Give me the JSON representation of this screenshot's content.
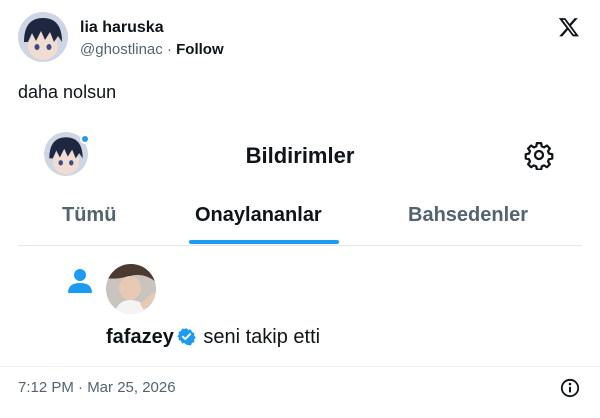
{
  "tweet": {
    "author_name": "lia haruska",
    "handle": "@ghostlinac",
    "separator": "·",
    "follow_label": "Follow",
    "text": "daha nolsun",
    "timestamp": "7:12 PM · Mar 25, 2026"
  },
  "screenshot": {
    "title": "Bildirimler",
    "tabs": [
      {
        "label": "Tümü",
        "active": false
      },
      {
        "label": "Onaylananlar",
        "active": true
      },
      {
        "label": "Bahsedenler",
        "active": false
      }
    ],
    "notification": {
      "username": "fafazey",
      "action": "seni takip etti"
    }
  },
  "icons": {
    "brand": "x-logo-icon",
    "settings": "gear-icon",
    "follow": "person-icon",
    "verified": "verified-badge-icon",
    "info": "info-icon"
  },
  "colors": {
    "accent": "#1d9bf0",
    "text": "#0f1419",
    "muted": "#536471"
  }
}
